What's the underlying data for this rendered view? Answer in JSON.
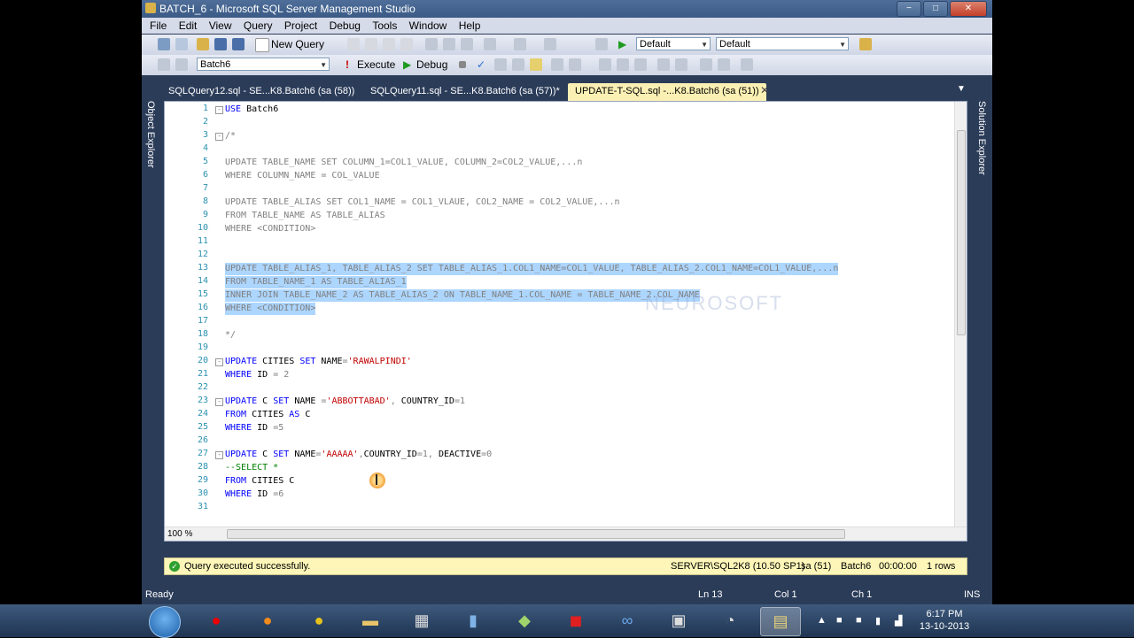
{
  "window": {
    "title": "BATCH_6 - Microsoft SQL Server Management Studio",
    "min": "−",
    "max": "□",
    "close": "✕"
  },
  "menu": [
    "File",
    "Edit",
    "View",
    "Query",
    "Project",
    "Debug",
    "Tools",
    "Window",
    "Help"
  ],
  "toolbar1": {
    "new_query": "New Query",
    "combo1": "Default",
    "combo2": "Default"
  },
  "toolbar2": {
    "database": "Batch6",
    "execute": "Execute",
    "debug": "Debug"
  },
  "tabs": [
    {
      "label": "SQLQuery12.sql - SE...K8.Batch6 (sa (58))"
    },
    {
      "label": "SQLQuery11.sql - SE...K8.Batch6 (sa (57))*"
    },
    {
      "label": "UPDATE-T-SQL.sql -...K8.Batch6 (sa (51))"
    }
  ],
  "side_panels": {
    "left": "Object Explorer",
    "right": "Solution Explorer"
  },
  "code_lines": [
    "USE Batch6",
    "",
    "/*",
    "",
    "UPDATE TABLE_NAME SET COLUMN_1=COL1_VALUE, COLUMN_2=COL2_VALUE,...n",
    "WHERE COLUMN_NAME = COL_VALUE",
    "",
    "UPDATE TABLE_ALIAS SET COL1_NAME = COL1_VLAUE, COL2_NAME = COL2_VALUE,...n",
    "FROM TABLE_NAME AS TABLE_ALIAS",
    "WHERE <CONDITION>",
    "",
    "",
    "UPDATE TABLE_ALIAS_1, TABLE_ALIAS_2 SET TABLE_ALIAS_1.COL1_NAME=COL1_VALUE, TABLE_ALIAS_2.COL1_NAME=COL1_VALUE,...n",
    "FROM TABLE_NAME_1 AS TABLE_ALIAS_1",
    "INNER JOIN TABLE_NAME_2 AS TABLE_ALIAS_2 ON TABLE_NAME_1.COL_NAME = TABLE_NAME_2.COL_NAME",
    "WHERE <CONDITION>",
    "",
    "*/",
    "",
    "UPDATE CITIES SET NAME='RAWALPINDI'",
    "WHERE ID = 2",
    "",
    "UPDATE C SET NAME ='ABBOTTABAD', COUNTRY_ID=1",
    "FROM CITIES AS C",
    "WHERE ID =5",
    "",
    "UPDATE C SET NAME='AAAAA',COUNTRY_ID=1, DEACTIVE=0",
    "--SELECT *",
    "FROM CITIES C",
    "WHERE ID =6",
    ""
  ],
  "editor": {
    "zoom": "100 %"
  },
  "status": {
    "message": "Query executed successfully.",
    "server": "SERVER\\SQL2K8 (10.50 SP1)",
    "user": "sa (51)",
    "db": "Batch6",
    "time": "00:00:00",
    "rows": "1 rows"
  },
  "statusbar": {
    "ready": "Ready",
    "ln": "Ln 13",
    "col": "Col 1",
    "ch": "Ch 1",
    "ins": "INS"
  },
  "clock": {
    "time": "6:17 PM",
    "date": "13-10-2013"
  },
  "watermark": "NEUROSOFT"
}
